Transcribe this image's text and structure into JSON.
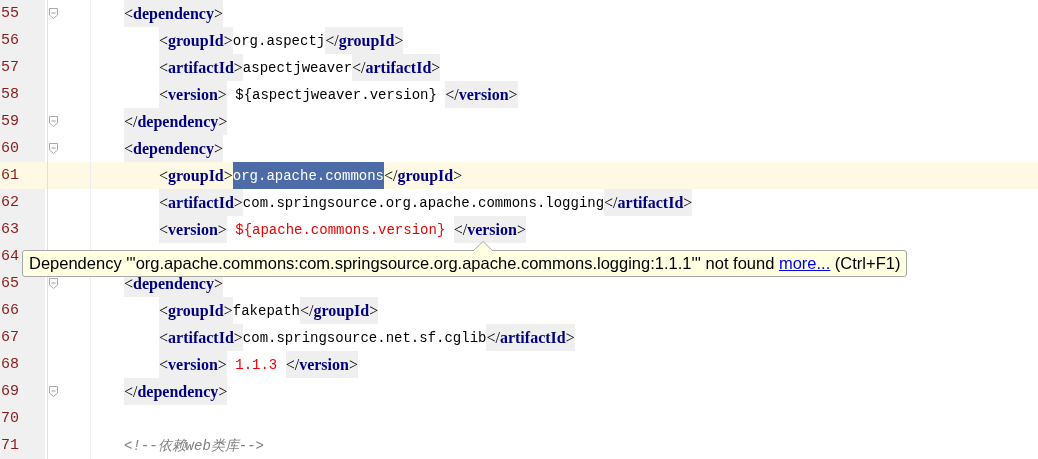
{
  "editor": {
    "lines": [
      {
        "number": "55",
        "fold": true,
        "current": false,
        "tokens": [
          {
            "kind": "tag",
            "text": "<**dependency**>"
          }
        ],
        "children": [
          {
            "number": "56",
            "fold": false,
            "current": false,
            "tokens": [
              {
                "kind": "tag",
                "text": "<**groupId**>"
              },
              {
                "kind": "text",
                "text": "org.aspectj"
              },
              {
                "kind": "tag",
                "text": "</**groupId**>"
              }
            ]
          },
          {
            "number": "57",
            "fold": false,
            "current": false,
            "tokens": [
              {
                "kind": "tag",
                "text": "<**artifactId**>"
              },
              {
                "kind": "text",
                "text": "aspectjweaver"
              },
              {
                "kind": "tag",
                "text": "</**artifactId**>"
              }
            ]
          },
          {
            "number": "58",
            "fold": false,
            "current": false,
            "tokens": [
              {
                "kind": "tag",
                "text": "<**version**>"
              },
              {
                "kind": "text",
                "text": " ${aspectjweaver.version} "
              },
              {
                "kind": "tag",
                "text": "</**version**>"
              }
            ]
          }
        ]
      },
      {
        "number": "59",
        "fold": true,
        "current": false,
        "tokens": [
          {
            "kind": "tag",
            "text": "</**dependency**>"
          }
        ]
      },
      {
        "number": "60",
        "fold": true,
        "current": false,
        "tokens": [
          {
            "kind": "tag",
            "text": "<**dependency**>"
          }
        ],
        "children": [
          {
            "number": "61",
            "fold": false,
            "current": true,
            "tokens": [
              {
                "kind": "tag",
                "text": "<**groupId**>"
              },
              {
                "kind": "selection",
                "text": "org.apache.commons"
              },
              {
                "kind": "tag",
                "text": "</**groupId**>"
              }
            ]
          },
          {
            "number": "62",
            "fold": false,
            "current": false,
            "tokens": [
              {
                "kind": "tag",
                "text": "<**artifactId**>"
              },
              {
                "kind": "text",
                "text": "com.springsource.org.apache.commons.logging"
              },
              {
                "kind": "tag",
                "text": "</**artifactId**>"
              }
            ]
          },
          {
            "number": "63",
            "fold": false,
            "current": false,
            "tokens": [
              {
                "kind": "tag",
                "text": "<**version**>"
              },
              {
                "kind": "value",
                "text": " ${apache.commons.version} "
              },
              {
                "kind": "tag",
                "text": "</**version**>"
              }
            ]
          }
        ]
      },
      {
        "number": "64",
        "fold": false,
        "current": false
      },
      {
        "number": "65",
        "fold": true,
        "current": false,
        "tokens": [
          {
            "kind": "tag",
            "text": "<**dependency**>"
          }
        ],
        "children": [
          {
            "number": "66",
            "fold": false,
            "current": false,
            "tokens": [
              {
                "kind": "tag",
                "text": "<**groupId**>"
              },
              {
                "kind": "text",
                "text": "fakepath"
              },
              {
                "kind": "tag",
                "text": "</**groupId**>"
              }
            ]
          },
          {
            "number": "67",
            "fold": false,
            "current": false,
            "tokens": [
              {
                "kind": "tag",
                "text": "<**artifactId**>"
              },
              {
                "kind": "text",
                "text": "com.springsource.net.sf.cglib"
              },
              {
                "kind": "tag",
                "text": "</**artifactId**>"
              }
            ]
          },
          {
            "number": "68",
            "fold": false,
            "current": false,
            "tokens": [
              {
                "kind": "tag",
                "text": "<**version**>"
              },
              {
                "kind": "value",
                "text": " 1.1.3 "
              },
              {
                "kind": "tag",
                "text": "</**version**>"
              }
            ]
          }
        ]
      },
      {
        "number": "69",
        "fold": true,
        "current": false,
        "tokens": [
          {
            "kind": "tag",
            "text": "</**dependency**>"
          }
        ]
      },
      {
        "number": "70",
        "fold": false,
        "current": false
      },
      {
        "number": "71",
        "fold": false,
        "current": false,
        "tokens": [
          {
            "kind": "comment",
            "text": "<!--依赖web类库-->"
          }
        ]
      }
    ]
  },
  "tooltip": {
    "message": "Dependency '''org.apache.commons:com.springsource.org.apache.commons.logging:1.1.1''' not found",
    "link": "more...",
    "shortcut": "(Ctrl+F1)"
  }
}
